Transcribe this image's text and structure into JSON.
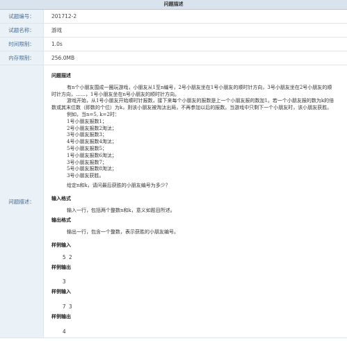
{
  "header": {
    "title": "问题描述"
  },
  "info_rows": [
    {
      "label": "试题编号：",
      "value": "201712-2"
    },
    {
      "label": "试题名称：",
      "value": "游戏"
    },
    {
      "label": "时间限制：",
      "value": "1.0s"
    },
    {
      "label": "内存限制：",
      "value": "256.0MB"
    }
  ],
  "desc_label": "问题描述：",
  "problem": {
    "title": "问题描述",
    "p1": "有n个小朋友围成一圈玩游戏，小朋友从1至n编号，2号小朋友坐在1号小朋友的顺时针方向，3号小朋友坐在2号小朋友的顺时针方向，……，1号小朋友坐在n号小朋友的顺时针方向。",
    "p2": "游戏开始，从1号小朋友开始顺时针报数，接下来每个小朋友的报数是上一个小朋友报的数加1。若一个小朋友报的数为k的倍数或其末位数（即数的个位）为k，则该小朋友被淘汰出局，不再参加以后的报数。当游戏中只剩下一个小朋友时，该小朋友获胜。",
    "example_lines": [
      "例如，当n=5, k=2时：",
      "1号小朋友报数1；",
      "2号小朋友报数2淘汰；",
      "3号小朋友报数3；",
      "4号小朋友报数4淘汰；",
      "5号小朋友报数5；",
      "1号小朋友报数6淘汰；",
      "3号小朋友报数7；",
      "5号小朋友报数8淘汰；",
      "3号小朋友获胜。"
    ],
    "question": "给定n和k，请问最后获胜的小朋友编号为多少？",
    "input_title": "输入格式",
    "input_text": "输入一行，包括两个整数n和k，意义如题目所述。",
    "output_title": "输出格式",
    "output_text": "输出一行，包含一个整数，表示获胜的小朋友编号。",
    "sample_input_title": "样例输入",
    "sample_input_1": "5 2",
    "sample_output_title": "样例输出",
    "sample_output_1": "3",
    "sample_input_2": "7 3",
    "sample_output_2": "4"
  }
}
